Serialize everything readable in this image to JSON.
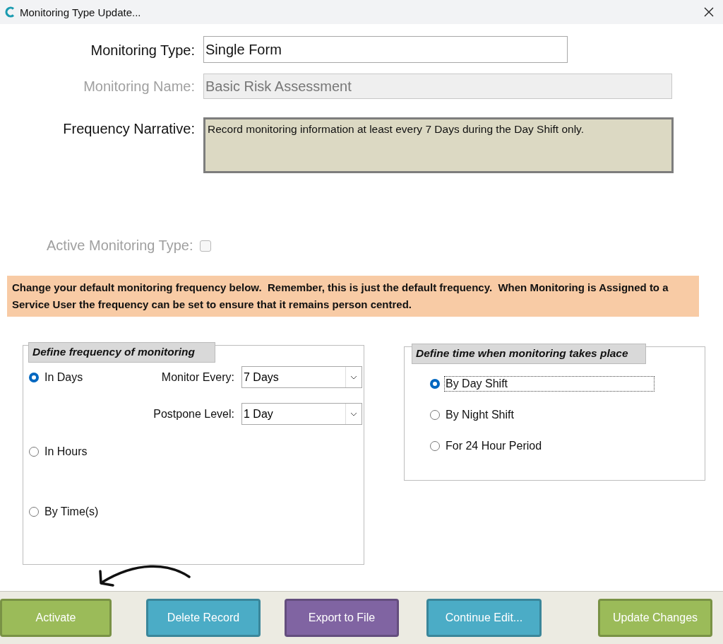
{
  "window": {
    "title": "Monitoring Type Update..."
  },
  "fields": [
    {
      "label": "Monitoring Type:",
      "value": "Single Form",
      "disabled": false
    },
    {
      "label": "Monitoring Name:",
      "value": "Basic Risk Assessment",
      "disabled": true
    }
  ],
  "narrative": {
    "label": "Frequency Narrative:",
    "value": "Record monitoring information at least every 7 Days during the Day Shift only."
  },
  "active": {
    "label": "Active Monitoring Type:",
    "checked": false,
    "disabled": true
  },
  "notice": "Change your default monitoring frequency below.  Remember, this is just the default frequency.  When Monitoring is Assigned to a Service User the frequency can be set to ensure that it remains person centred.",
  "frequency_group": {
    "title": "Define frequency of monitoring",
    "options": [
      {
        "label": "In Days",
        "selected": true
      },
      {
        "label": "In Hours",
        "selected": false
      },
      {
        "label": "By Time(s)",
        "selected": false
      }
    ],
    "dropdowns": [
      {
        "label": "Monitor Every:",
        "value": "7 Days"
      },
      {
        "label": "Postpone Level:",
        "value": "1 Day"
      }
    ]
  },
  "time_group": {
    "title": "Define time when monitoring takes place",
    "options": [
      {
        "label": "By Day Shift",
        "selected": true,
        "focused": true
      },
      {
        "label": "By Night Shift",
        "selected": false,
        "focused": false
      },
      {
        "label": "For 24 Hour Period",
        "selected": false,
        "focused": false
      }
    ]
  },
  "buttons": [
    {
      "label": "Activate",
      "color": "#9bbb59"
    },
    {
      "label": "Delete Record",
      "color": "#4bacc6"
    },
    {
      "label": "Export  to File",
      "color": "#8064a2"
    },
    {
      "label": "Continue Edit...",
      "color": "#4bacc6"
    },
    {
      "label": "Update Changes",
      "color": "#9bbb59"
    }
  ]
}
